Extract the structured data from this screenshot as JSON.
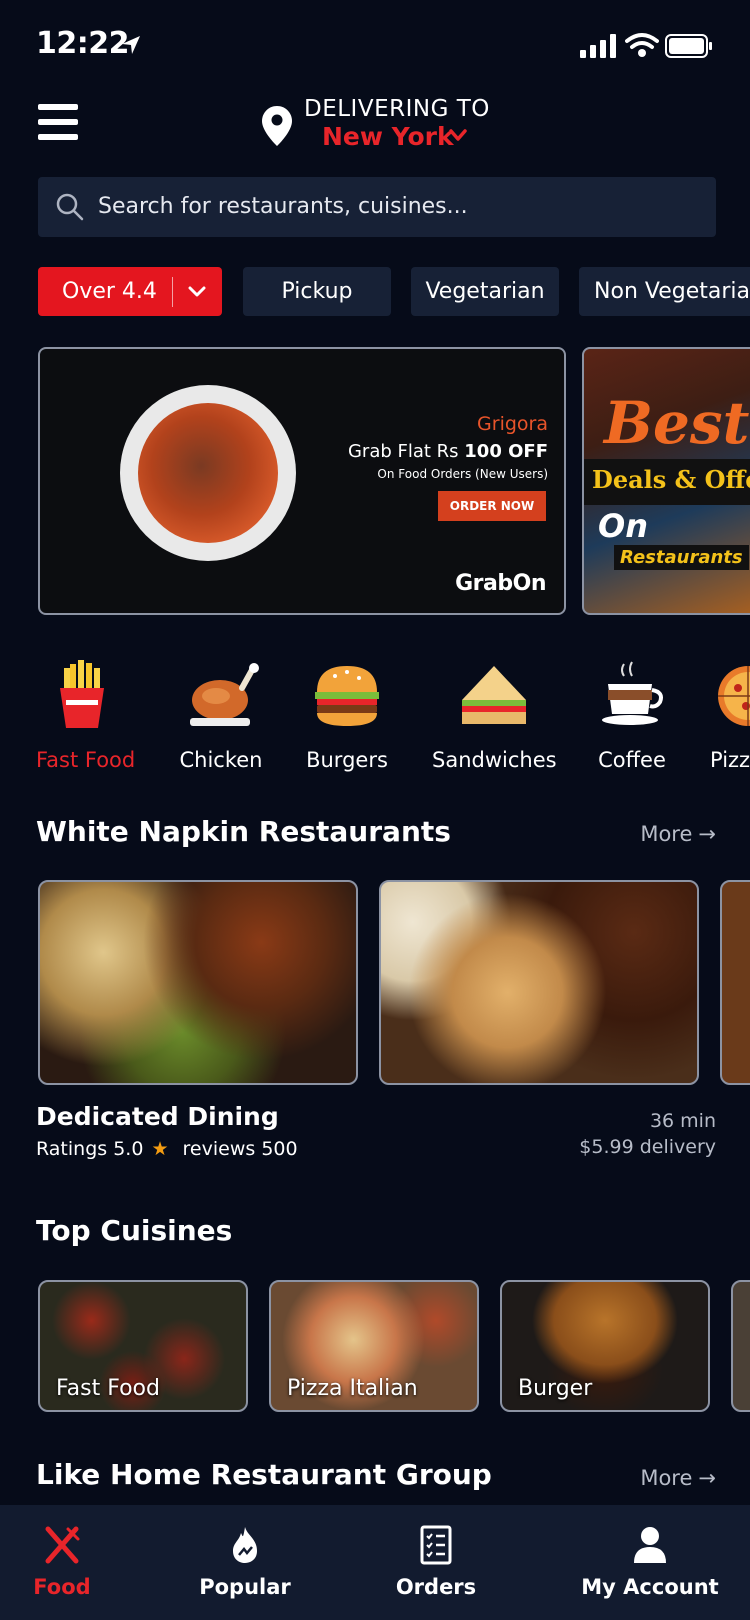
{
  "status_bar": {
    "time": "12:22"
  },
  "header": {
    "delivering_label": "DELIVERING TO",
    "city": "New York"
  },
  "search": {
    "placeholder": "Search for restaurants, cuisines..."
  },
  "filters": [
    {
      "label": "Over 4.4",
      "active": true
    },
    {
      "label": "Pickup",
      "active": false
    },
    {
      "label": "Vegetarian",
      "active": false
    },
    {
      "label": "Non Vegetarian",
      "active": false
    }
  ],
  "banners": {
    "promo1": {
      "brand": "Grigora",
      "headline_prefix": "Grab Flat Rs ",
      "headline_amount": "100 OFF",
      "subtext": "On Food Orders (New Users)",
      "cta": "ORDER NOW",
      "logo": "GrabOn"
    },
    "promo2": {
      "title": "Best",
      "line2": "Deals & Offers",
      "line3": "On",
      "line4": "Restaurants"
    }
  },
  "categories": [
    {
      "label": "Fast Food",
      "icon": "fries-icon",
      "active": true
    },
    {
      "label": "Chicken",
      "icon": "roast-chicken-icon",
      "active": false
    },
    {
      "label": "Burgers",
      "icon": "burger-icon",
      "active": false
    },
    {
      "label": "Sandwiches",
      "icon": "sandwich-icon",
      "active": false
    },
    {
      "label": "Coffee",
      "icon": "coffee-cup-icon",
      "active": false
    },
    {
      "label": "Pizza",
      "icon": "pizza-icon",
      "active": false
    }
  ],
  "white_napkin": {
    "title": "White Napkin Restaurants",
    "more": "More",
    "restaurant": {
      "name": "Dedicated Dining",
      "ratings_label": "Ratings",
      "rating": "5.0",
      "reviews_label": "reviews",
      "reviews": "500",
      "time": "36 min",
      "delivery": "$5.99 delivery"
    }
  },
  "top_cuisines": {
    "title": "Top Cuisines",
    "items": [
      "Fast Food",
      "Pizza Italian",
      "Burger"
    ]
  },
  "like_home": {
    "title": "Like Home Restaurant Group",
    "more": "More"
  },
  "bottom_nav": [
    {
      "label": "Food",
      "icon": "fork-knife-icon",
      "active": true
    },
    {
      "label": "Popular",
      "icon": "flame-icon",
      "active": false
    },
    {
      "label": "Orders",
      "icon": "checklist-icon",
      "active": false
    },
    {
      "label": "My Account",
      "icon": "user-icon",
      "active": false
    }
  ],
  "colors": {
    "background": "#060b19",
    "accent": "#e8252a",
    "surface": "#172136",
    "nav_background": "#121b2f",
    "star": "#f39c12"
  }
}
